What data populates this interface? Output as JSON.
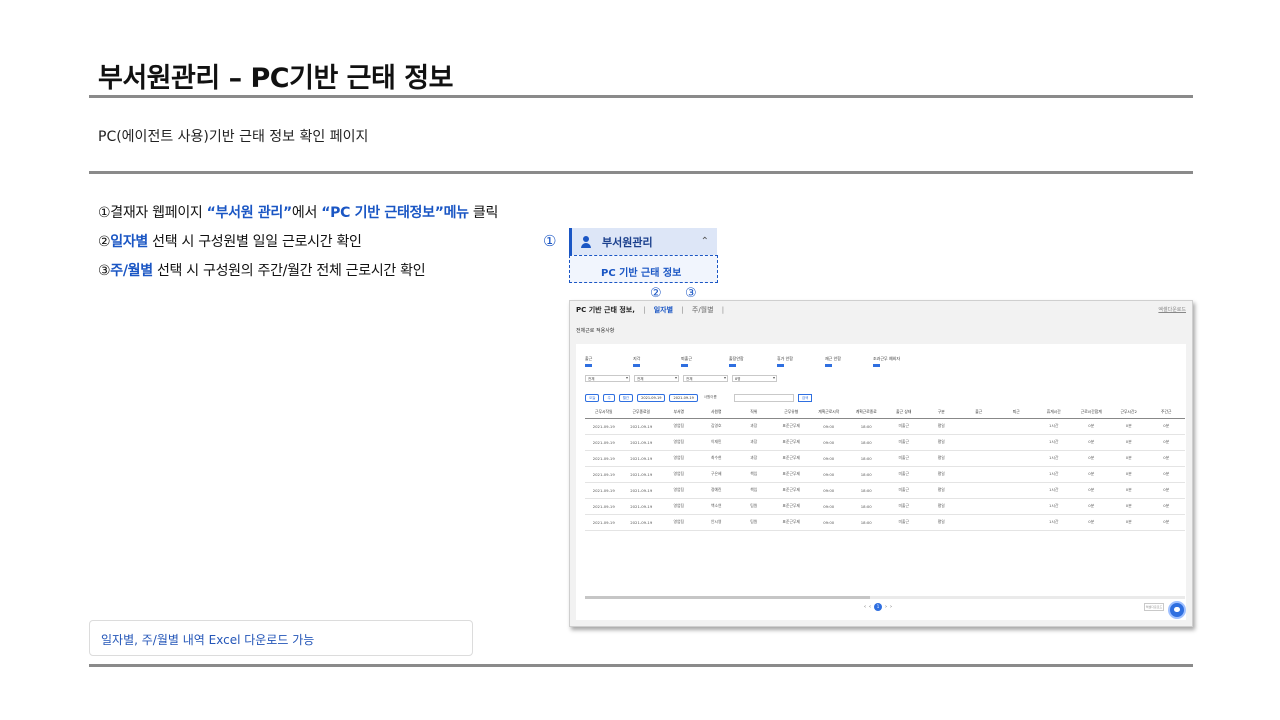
{
  "slide": {
    "title": "부서원관리 – PC기반 근태 정보",
    "description": "PC(에이전트 사용)기반 근태 정보 확인 페이지",
    "note": "일자별, 주/월별 내역 Excel 다운로드 가능"
  },
  "steps": [
    {
      "num": "①",
      "prefix": "결재자 웹페이지 ",
      "hl1": "“부서원 관리”",
      "mid": "에서 ",
      "hl2": "“PC 기반 근태정보”메뉴",
      "suffix": " 클릭"
    },
    {
      "num": "②",
      "hl1": "일자별",
      "suffix": " 선택 시 구성원별 일일 근로시간 확인"
    },
    {
      "num": "③",
      "hl1": "주/월별",
      "suffix": " 선택 시 구성원의 주간/월간 전체 근로시간 확인"
    }
  ],
  "callouts": {
    "c1": "①",
    "c2": "②",
    "c3": "③"
  },
  "menu": {
    "icon": "user-icon",
    "section_label": "부서원관리",
    "chevron": "⌃",
    "sub_item": "PC 기반 근태 정보"
  },
  "app": {
    "tab_title": "PC 기반 근태 정보,",
    "tab_daily": "일자별",
    "tab_weekly": "주/월별",
    "sep": "|",
    "top_link": "엑셀다운로드",
    "section_label": "전체근로 적용사항",
    "filters": [
      "출근",
      "지각",
      "퇴출근",
      "출장안함",
      "휴가 안함",
      "재근 안함",
      "조과근무 예외자"
    ],
    "selects": [
      "전체",
      "전체",
      "전체",
      "8명"
    ],
    "buttons": {
      "prev": "오늘",
      "week": "주",
      "month": "월간",
      "date_from": "2021-09-19",
      "date_to": "2021-09-19",
      "search_type": "사원이름",
      "search": "검색"
    },
    "columns": [
      "근무시작일",
      "근무종료일",
      "부서명",
      "사원명",
      "직위",
      "근무유형",
      "계획근로시작",
      "계획근로종료",
      "출근 상태",
      "구분",
      "출근",
      "퇴근",
      "휴게시간",
      "근로시간합계",
      "근무시간2",
      "주간근"
    ],
    "rows": [
      [
        "2021-09-19",
        "2021-09-19",
        "영업팀",
        "김영호",
        "과장",
        "표준근무제",
        "09:00",
        "18:00",
        "미출근",
        "평일",
        "",
        "",
        "1시간",
        "0분",
        "0분",
        "0분"
      ],
      [
        "2021-09-19",
        "2021-09-19",
        "영업팀",
        "이재민",
        "과장",
        "표준근무제",
        "09:00",
        "18:00",
        "미출근",
        "평일",
        "",
        "",
        "1시간",
        "0분",
        "0분",
        "0분"
      ],
      [
        "2021-09-19",
        "2021-09-19",
        "영업팀",
        "최수현",
        "과장",
        "표준근무제",
        "09:00",
        "18:00",
        "미출근",
        "평일",
        "",
        "",
        "1시간",
        "0분",
        "0분",
        "0분"
      ],
      [
        "2021-09-19",
        "2021-09-19",
        "영업팀",
        "구은혜",
        "책임",
        "표준근무제",
        "09:00",
        "18:00",
        "미출근",
        "평일",
        "",
        "",
        "1시간",
        "0분",
        "0분",
        "0분"
      ],
      [
        "2021-09-19",
        "2021-09-19",
        "영업팀",
        "정예린",
        "책임",
        "표준근무제",
        "09:00",
        "18:00",
        "미출근",
        "평일",
        "",
        "",
        "1시간",
        "0분",
        "0분",
        "0분"
      ],
      [
        "2021-09-19",
        "2021-09-19",
        "영업팀",
        "백소연",
        "팀원",
        "표준근무제",
        "09:00",
        "18:00",
        "미출근",
        "평일",
        "",
        "",
        "1시간",
        "0분",
        "0분",
        "0분"
      ],
      [
        "2021-09-19",
        "2021-09-19",
        "영업팀",
        "안시영",
        "팀원",
        "표준근무제",
        "09:00",
        "18:00",
        "미출근",
        "평일",
        "",
        "",
        "1시간",
        "0분",
        "0분",
        "0분"
      ]
    ],
    "pager": {
      "first": "‹",
      "prev": "‹",
      "current": "1",
      "next": "›",
      "last": "›"
    },
    "excel_button": "엑셀다운로드",
    "chat_icon": "chat-icon"
  },
  "colors": {
    "accent": "#1a56c4",
    "rule": "#8a8a8a",
    "app_blue": "#2f6fe0"
  }
}
